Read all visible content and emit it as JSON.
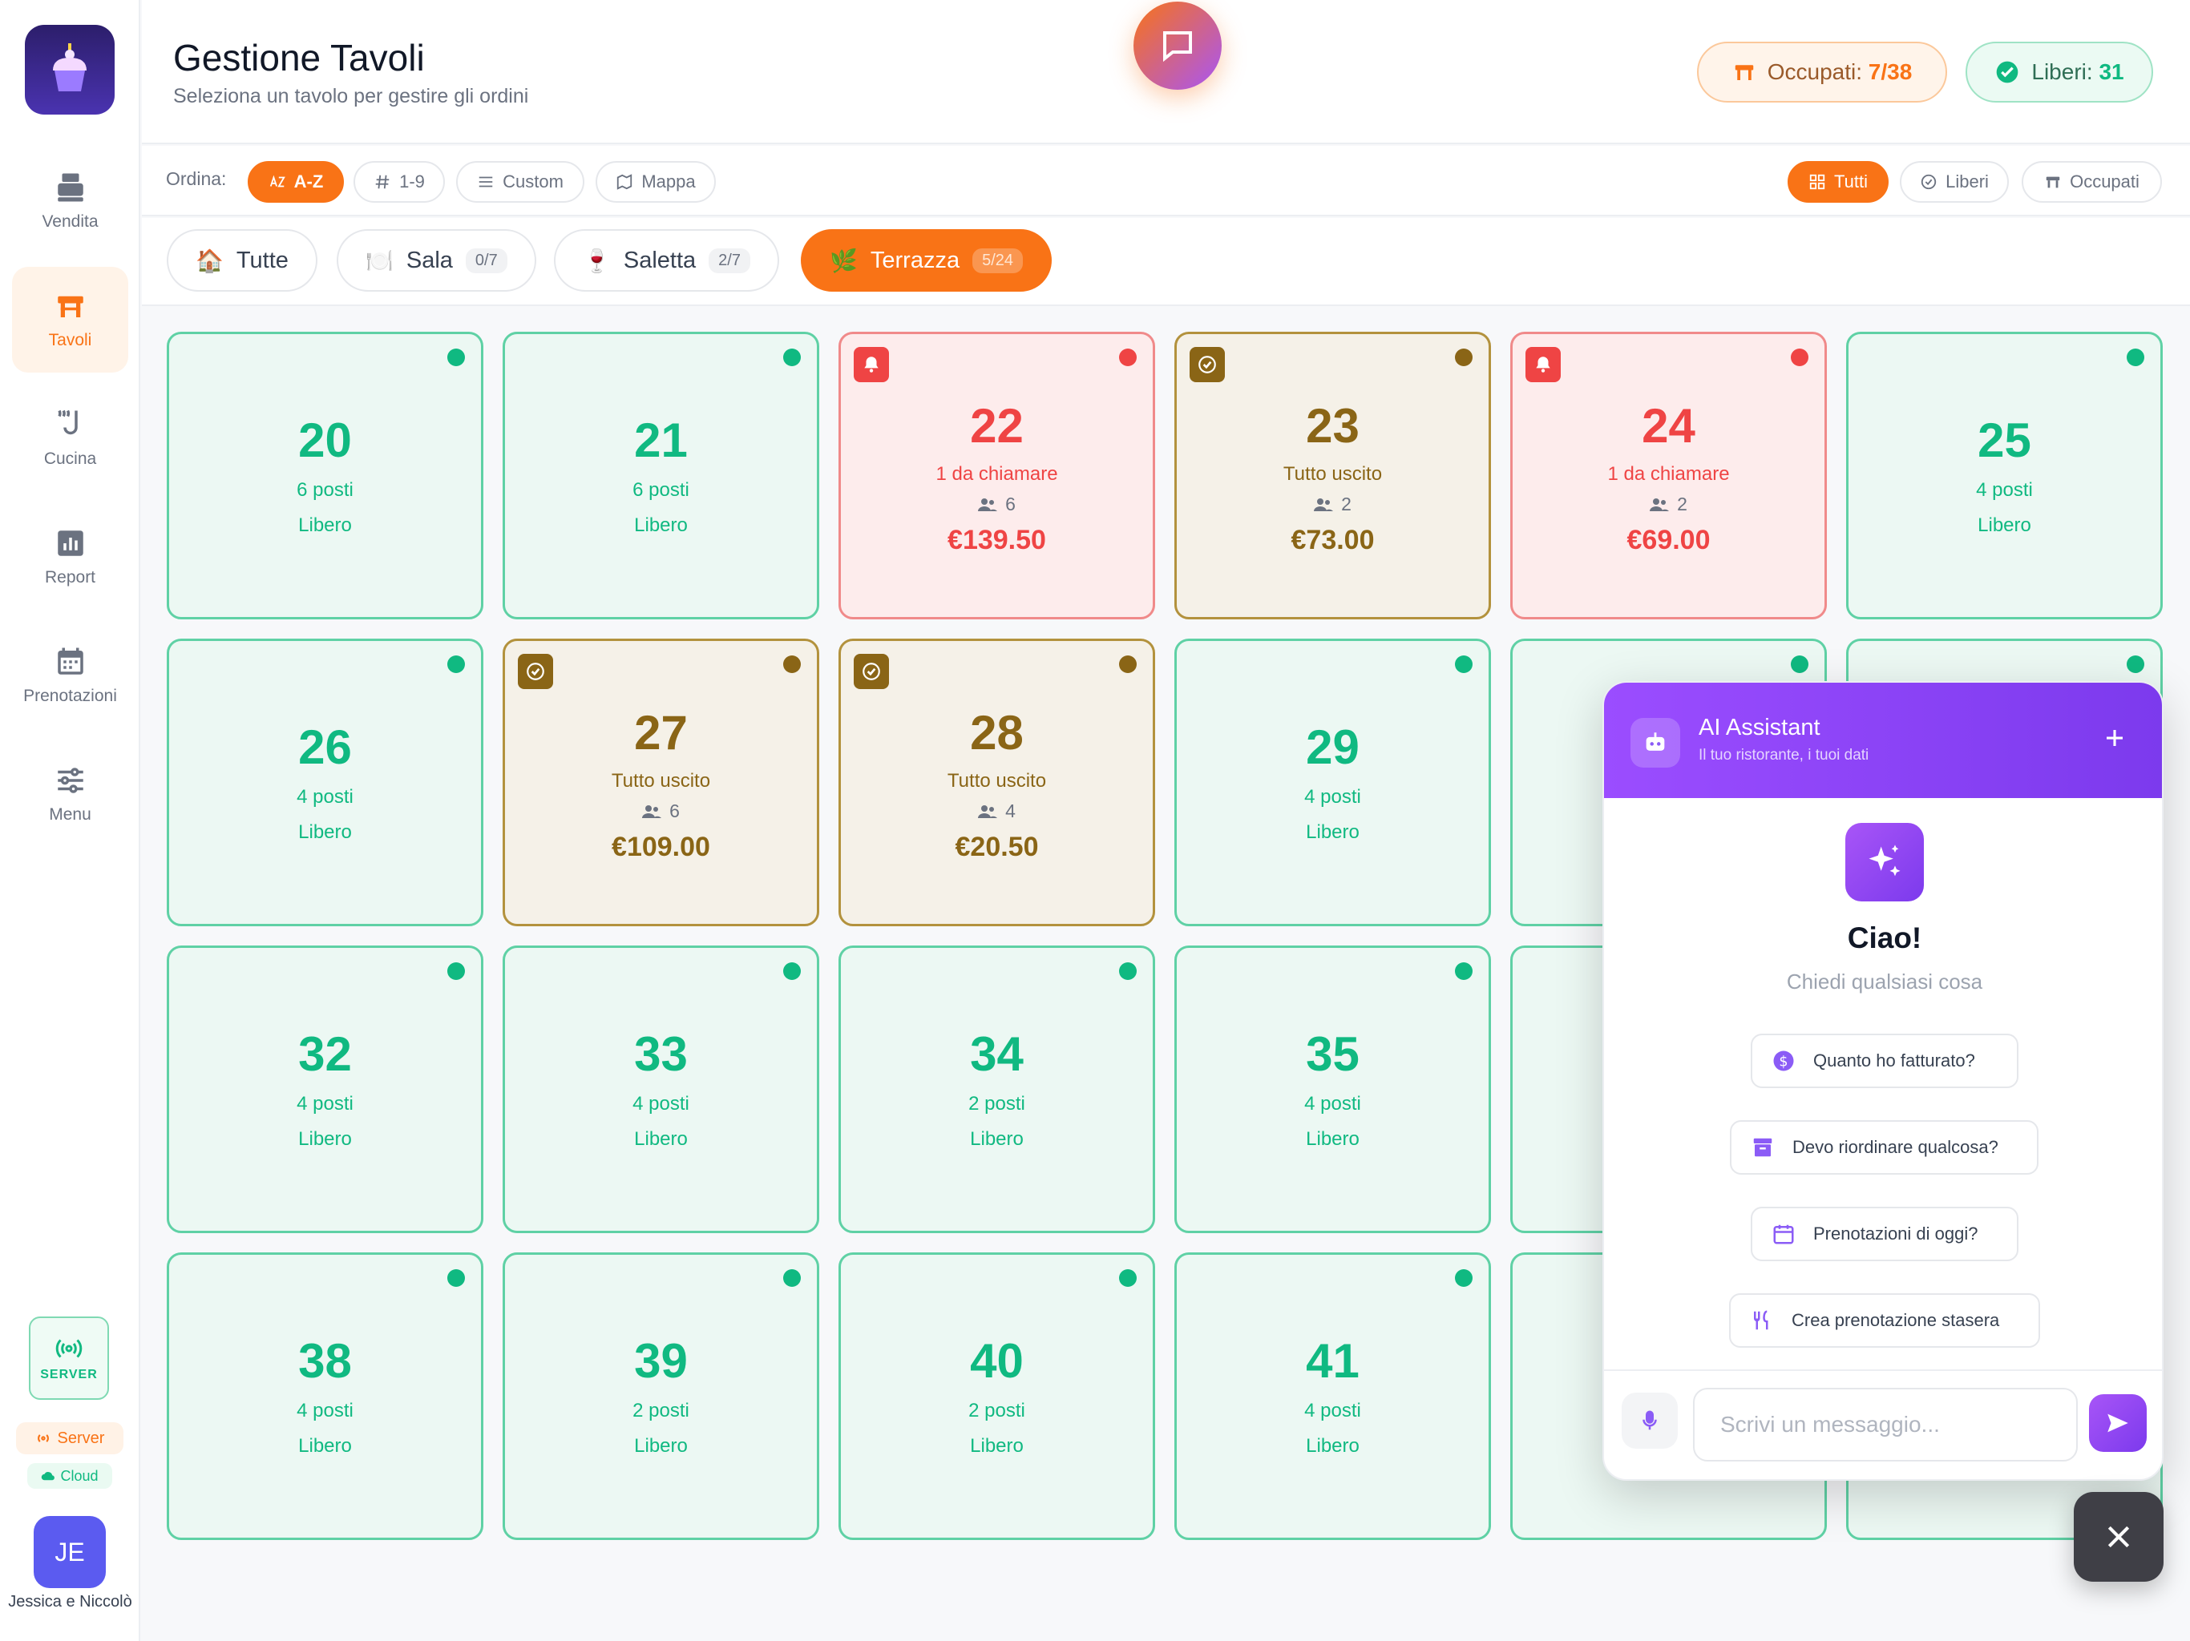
{
  "sidebar": {
    "items": [
      {
        "label": "Vendita",
        "icon": "register-icon"
      },
      {
        "label": "Tavoli",
        "icon": "table-icon"
      },
      {
        "label": "Cucina",
        "icon": "kitchen-icon"
      },
      {
        "label": "Report",
        "icon": "report-icon"
      },
      {
        "label": "Prenotazioni",
        "icon": "calendar-icon"
      },
      {
        "label": "Menu",
        "icon": "sliders-icon"
      }
    ],
    "server_box": "SERVER",
    "server_pill": "Server",
    "cloud_pill": "Cloud",
    "avatar_initials": "JE",
    "user_name": "Jessica e Niccolò"
  },
  "header": {
    "title": "Gestione Tavoli",
    "subtitle": "Seleziona un tavolo per gestire gli ordini",
    "occupied_label": "Occupati:",
    "occupied_value": "7/38",
    "free_label": "Liberi:",
    "free_value": "31"
  },
  "toolbar": {
    "sort_label": "Ordina:",
    "sort_options": [
      "A-Z",
      "1-9",
      "Custom",
      "Mappa"
    ],
    "filter_options": [
      "Tutti",
      "Liberi",
      "Occupati"
    ]
  },
  "rooms": [
    {
      "emoji": "🏠",
      "label": "Tutte",
      "count": ""
    },
    {
      "emoji": "🍽️",
      "label": "Sala",
      "count": "0/7"
    },
    {
      "emoji": "🍷",
      "label": "Saletta",
      "count": "2/7"
    },
    {
      "emoji": "🌿",
      "label": "Terrazza",
      "count": "5/24"
    }
  ],
  "tables": [
    {
      "num": "20",
      "status": "free",
      "seats": "6 posti",
      "state": "Libero"
    },
    {
      "num": "21",
      "status": "free",
      "seats": "6 posti",
      "state": "Libero"
    },
    {
      "num": "22",
      "status": "call",
      "note": "1 da chiamare",
      "guests": "6",
      "amount": "€139.50"
    },
    {
      "num": "23",
      "status": "done",
      "note": "Tutto uscito",
      "guests": "2",
      "amount": "€73.00"
    },
    {
      "num": "24",
      "status": "call",
      "note": "1 da chiamare",
      "guests": "2",
      "amount": "€69.00"
    },
    {
      "num": "25",
      "status": "free",
      "seats": "4 posti",
      "state": "Libero"
    },
    {
      "num": "26",
      "status": "free",
      "seats": "4 posti",
      "state": "Libero"
    },
    {
      "num": "27",
      "status": "done",
      "note": "Tutto uscito",
      "guests": "6",
      "amount": "€109.00"
    },
    {
      "num": "28",
      "status": "done",
      "note": "Tutto uscito",
      "guests": "4",
      "amount": "€20.50"
    },
    {
      "num": "29",
      "status": "free",
      "seats": "4 posti",
      "state": "Libero"
    },
    {
      "num": "",
      "status": "free",
      "seats": "",
      "state": ""
    },
    {
      "num": "",
      "status": "free",
      "seats": "",
      "state": ""
    },
    {
      "num": "32",
      "status": "free",
      "seats": "4 posti",
      "state": "Libero"
    },
    {
      "num": "33",
      "status": "free",
      "seats": "4 posti",
      "state": "Libero"
    },
    {
      "num": "34",
      "status": "free",
      "seats": "2 posti",
      "state": "Libero"
    },
    {
      "num": "35",
      "status": "free",
      "seats": "4 posti",
      "state": "Libero"
    },
    {
      "num": "",
      "status": "free",
      "seats": "",
      "state": ""
    },
    {
      "num": "",
      "status": "free",
      "seats": "",
      "state": ""
    },
    {
      "num": "38",
      "status": "free",
      "seats": "4 posti",
      "state": "Libero"
    },
    {
      "num": "39",
      "status": "free",
      "seats": "2 posti",
      "state": "Libero"
    },
    {
      "num": "40",
      "status": "free",
      "seats": "2 posti",
      "state": "Libero"
    },
    {
      "num": "41",
      "status": "free",
      "seats": "4 posti",
      "state": "Libero"
    },
    {
      "num": "",
      "status": "free",
      "seats": "",
      "state": ""
    },
    {
      "num": "",
      "status": "free",
      "seats": "",
      "state": ""
    }
  ],
  "ai": {
    "title": "AI Assistant",
    "subtitle": "Il tuo ristorante, i tuoi dati",
    "greeting": "Ciao!",
    "prompt": "Chiedi qualsiasi cosa",
    "suggestions": [
      {
        "label": "Quanto ho fatturato?",
        "icon": "dollar-icon"
      },
      {
        "label": "Devo riordinare qualcosa?",
        "icon": "archive-icon"
      },
      {
        "label": "Prenotazioni di oggi?",
        "icon": "calendar-icon"
      },
      {
        "label": "Crea prenotazione stasera",
        "icon": "utensils-icon"
      }
    ],
    "input_placeholder": "Scrivi un messaggio..."
  },
  "colors": {
    "accent": "#f97316",
    "free": "#10b981",
    "call": "#ef4444",
    "done": "#8a6516",
    "ai": "#7c3aed"
  }
}
